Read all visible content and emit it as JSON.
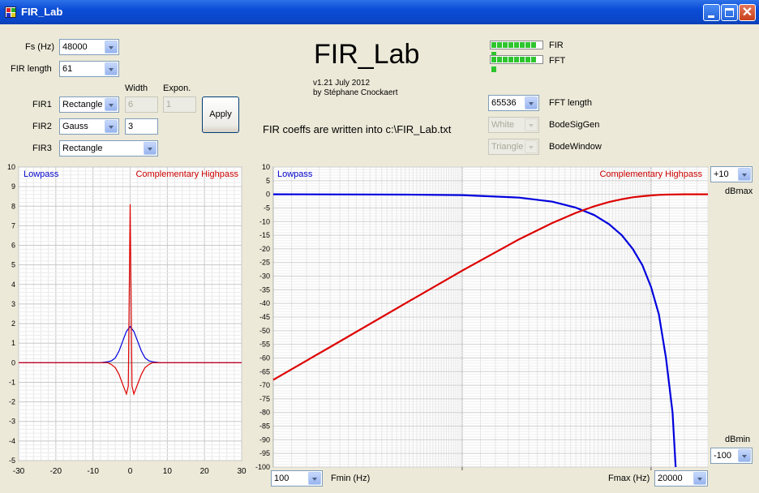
{
  "window": {
    "title": "FIR_Lab"
  },
  "app": {
    "title": "FIR_Lab",
    "version": "v1.21 July 2012",
    "author": "by Stéphane Cnockaert",
    "note": "FIR coeffs are written into c:\\FIR_Lab.txt"
  },
  "controls": {
    "fs_label": "Fs (Hz)",
    "fs_value": "48000",
    "firlen_label": "FIR length",
    "firlen_value": "61",
    "width_header": "Width",
    "expon_header": "Expon.",
    "fir1_label": "FIR1",
    "fir1_type": "Rectangle",
    "fir1_width": "6",
    "fir1_expon": "1",
    "fir2_label": "FIR2",
    "fir2_type": "Gauss",
    "fir2_width": "3",
    "fir3_label": "FIR3",
    "fir3_type": "Rectangle",
    "apply_label": "Apply",
    "fir_led_label": "FIR",
    "fft_led_label": "FFT",
    "fftlen_value": "65536",
    "fftlen_label": "FFT length",
    "sig_value": "White",
    "sig_label": "BodeSigGen",
    "win_value": "Triangle",
    "win_label": "BodeWindow",
    "dbmax_value": "+10",
    "dbmax_label": "dBmax",
    "dbmin_value": "-100",
    "dbmin_label": "dBmin",
    "fmin_value": "100",
    "fmin_label": "Fmin (Hz)",
    "fmax_value": "20000",
    "fmax_label": "Fmax (Hz)"
  },
  "chart_data": [
    {
      "type": "line",
      "legend": [
        "Lowpass",
        "Complementary Highpass"
      ],
      "xlim": [
        -30,
        30
      ],
      "ylim": [
        -5,
        10
      ],
      "x_ticks": [
        -30,
        -20,
        -10,
        0,
        10,
        20,
        30
      ],
      "y_ticks": [
        -5,
        -4,
        -3,
        -2,
        -1,
        0,
        1,
        2,
        3,
        4,
        5,
        6,
        7,
        8,
        9,
        10
      ],
      "grid": true,
      "series": [
        {
          "name": "Lowpass",
          "color": "#0000dd",
          "x": [
            -30,
            -8,
            -6,
            -5,
            -4,
            -3,
            -2,
            -1,
            0,
            1,
            2,
            3,
            4,
            5,
            6,
            8,
            30
          ],
          "y": [
            0,
            0,
            0.05,
            0.1,
            0.25,
            0.6,
            1.1,
            1.6,
            1.85,
            1.6,
            1.1,
            0.6,
            0.25,
            0.1,
            0.05,
            0,
            0
          ]
        },
        {
          "name": "Complementary Highpass",
          "color": "#dd0000",
          "x": [
            -30,
            -6,
            -5,
            -4,
            -3,
            -2,
            -1,
            -0.5,
            0,
            0.5,
            1,
            2,
            3,
            4,
            5,
            6,
            30
          ],
          "y": [
            0,
            0,
            -0.1,
            -0.25,
            -0.6,
            -1.1,
            -1.6,
            -1.2,
            8.1,
            -1.2,
            -1.6,
            -1.1,
            -0.6,
            -0.25,
            -0.1,
            0,
            0
          ]
        }
      ]
    },
    {
      "type": "line",
      "legend": [
        "Lowpass",
        "Complementary Highpass"
      ],
      "xscale": "log",
      "xlim": [
        100,
        20000
      ],
      "ylim": [
        -100,
        10
      ],
      "y_ticks": [
        10,
        5,
        0,
        -5,
        -10,
        -15,
        -20,
        -25,
        -30,
        -35,
        -40,
        -45,
        -50,
        -55,
        -60,
        -65,
        -70,
        -75,
        -80,
        -85,
        -90,
        -95,
        -100
      ],
      "grid": true,
      "series": [
        {
          "name": "Lowpass",
          "color": "#0000dd",
          "x": [
            100,
            500,
            1000,
            2000,
            3000,
            4000,
            5000,
            6000,
            7000,
            8000,
            9000,
            10000,
            11000,
            12000,
            13000,
            13500
          ],
          "y": [
            0,
            -0.1,
            -0.3,
            -1.2,
            -2.7,
            -4.9,
            -7.6,
            -11,
            -15,
            -20,
            -26,
            -34,
            -44,
            -60,
            -80,
            -100
          ]
        },
        {
          "name": "Complementary Highpass",
          "color": "#dd0000",
          "x": [
            100,
            200,
            500,
            1000,
            2000,
            3000,
            4000,
            5000,
            6000,
            7000,
            8000,
            9000,
            10000,
            11000,
            12000,
            15000,
            20000
          ],
          "y": [
            -68,
            -56,
            -40,
            -28,
            -16.5,
            -10.5,
            -6.8,
            -4.4,
            -2.8,
            -1.8,
            -1.1,
            -0.7,
            -0.4,
            -0.2,
            -0.1,
            0,
            0
          ]
        }
      ]
    }
  ]
}
